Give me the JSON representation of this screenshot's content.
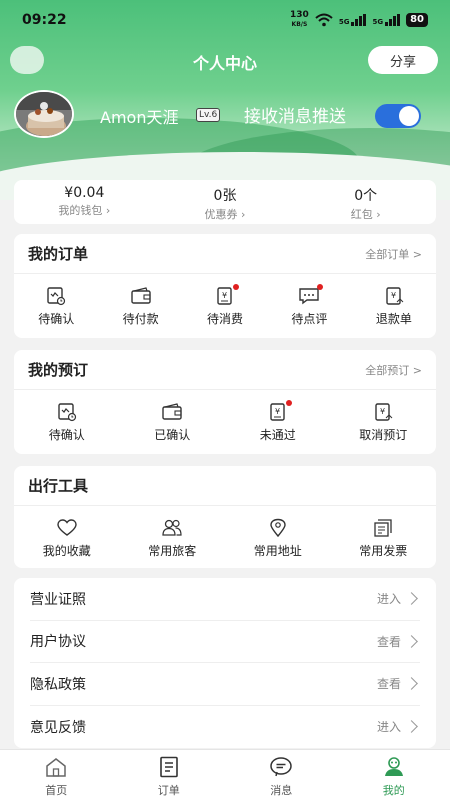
{
  "status": {
    "time": "09:22",
    "net_speed": "130",
    "net_unit": "KB/S",
    "sig1": "5G",
    "sig2": "5G",
    "battery": "80"
  },
  "header": {
    "title": "个人中心",
    "share_label": "分享"
  },
  "profile": {
    "username": "Amon天涯",
    "level": "Lv.6",
    "push_label": "接收消息推送",
    "push_enabled": true
  },
  "wallet": [
    {
      "value": "¥0.04",
      "label": "我的钱包 ›"
    },
    {
      "value": "0张",
      "label": "优惠券 ›"
    },
    {
      "value": "0个",
      "label": "红包 ›"
    }
  ],
  "orders": {
    "title": "我的订单",
    "more": "全部订单 >",
    "items": [
      {
        "label": "待确认",
        "icon": "pending-confirm-icon",
        "dot": false
      },
      {
        "label": "待付款",
        "icon": "wallet-icon",
        "dot": false
      },
      {
        "label": "待消费",
        "icon": "voucher-icon",
        "dot": true
      },
      {
        "label": "待点评",
        "icon": "comment-icon",
        "dot": true
      },
      {
        "label": "退款单",
        "icon": "refund-icon",
        "dot": false
      }
    ]
  },
  "bookings": {
    "title": "我的预订",
    "more": "全部预订 >",
    "items": [
      {
        "label": "待确认",
        "icon": "pending-confirm-icon",
        "dot": false
      },
      {
        "label": "已确认",
        "icon": "wallet-icon",
        "dot": false
      },
      {
        "label": "未通过",
        "icon": "voucher-icon",
        "dot": true
      },
      {
        "label": "取消预订",
        "icon": "refund-icon",
        "dot": false
      }
    ]
  },
  "tools": {
    "title": "出行工具",
    "items": [
      {
        "label": "我的收藏",
        "icon": "heart-icon"
      },
      {
        "label": "常用旅客",
        "icon": "travelers-icon"
      },
      {
        "label": "常用地址",
        "icon": "location-icon"
      },
      {
        "label": "常用发票",
        "icon": "invoice-icon"
      }
    ]
  },
  "menu": [
    {
      "label": "营业证照",
      "action": "进入"
    },
    {
      "label": "用户协议",
      "action": "查看"
    },
    {
      "label": "隐私政策",
      "action": "查看"
    },
    {
      "label": "意见反馈",
      "action": "进入"
    }
  ],
  "tabbar": [
    {
      "label": "首页",
      "icon": "home-icon",
      "active": false
    },
    {
      "label": "订单",
      "icon": "order-icon",
      "active": false
    },
    {
      "label": "消息",
      "icon": "message-icon",
      "active": false
    },
    {
      "label": "我的",
      "icon": "profile-icon",
      "active": true
    }
  ],
  "colors": {
    "brand_green": "#4cc07a",
    "active_tab": "#2f9a55",
    "toggle_on": "#2a6fdc",
    "badge_red": "#e02020"
  }
}
